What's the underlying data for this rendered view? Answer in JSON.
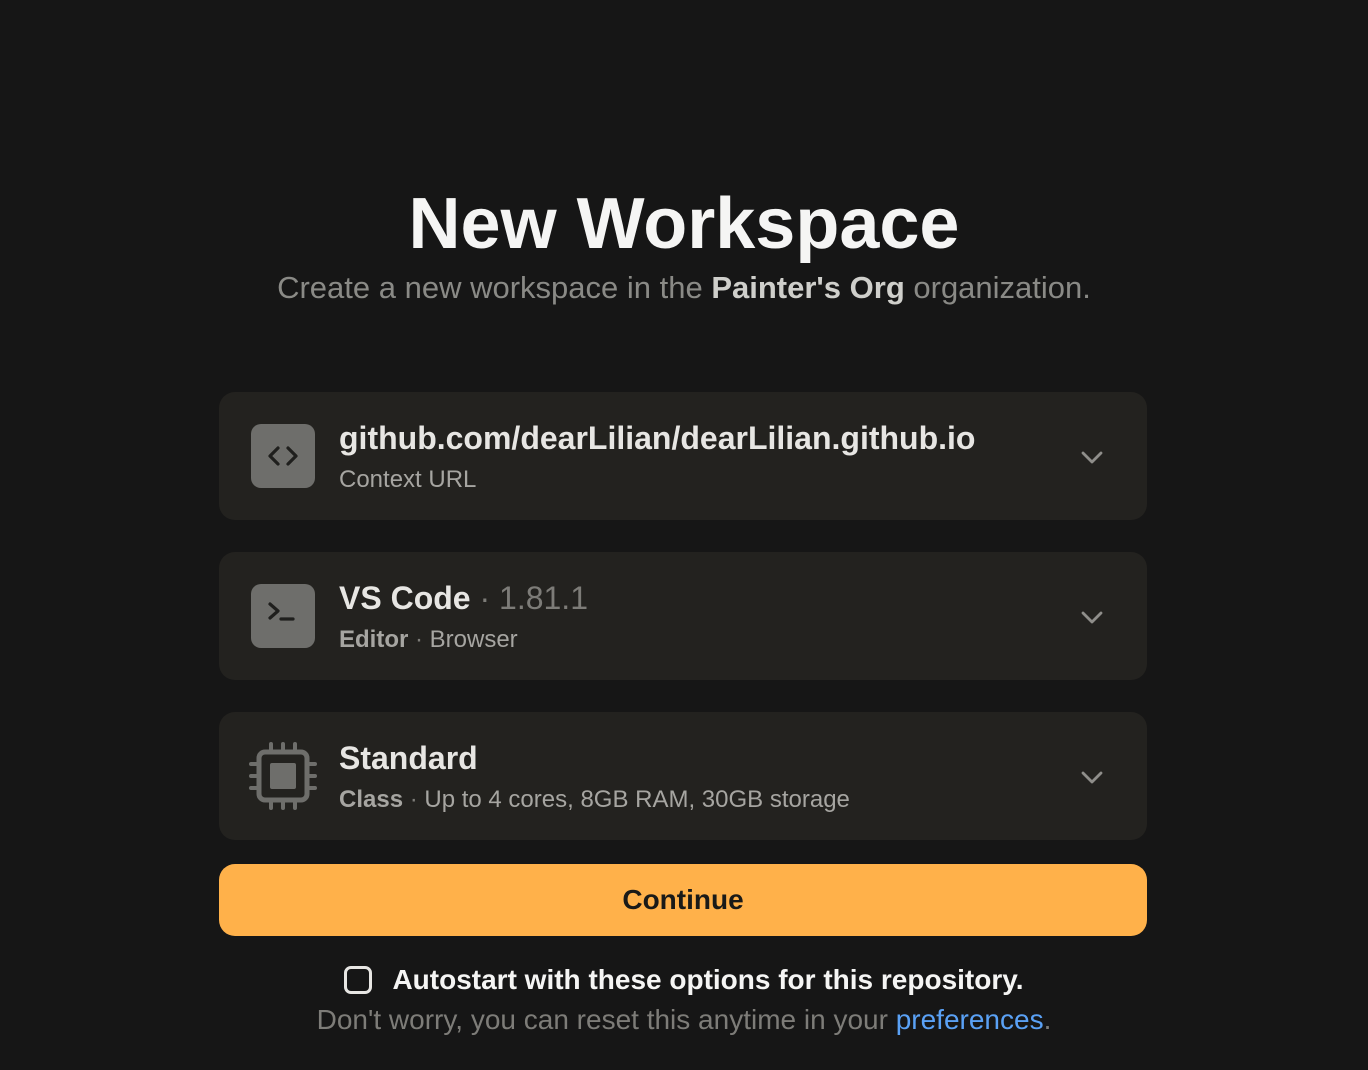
{
  "header": {
    "title": "New Workspace",
    "subtitle_prefix": "Create a new workspace in the ",
    "org_name": "Painter's Org",
    "subtitle_suffix": " organization."
  },
  "context_card": {
    "icon": "code-brackets-icon",
    "primary": "github.com/dearLilian/dearLilian.github.io",
    "secondary": "Context URL"
  },
  "editor_card": {
    "icon": "terminal-icon",
    "name": "VS Code",
    "version": " · 1.81.1",
    "type_label": "Editor",
    "separator": " · ",
    "mode": "Browser"
  },
  "class_card": {
    "icon": "cpu-chip-icon",
    "name": "Standard",
    "type_label": "Class",
    "separator": " · ",
    "spec": "Up to 4 cores, 8GB RAM, 30GB storage"
  },
  "actions": {
    "continue_label": "Continue"
  },
  "autostart": {
    "checked": false,
    "label": "Autostart with these options for this repository.",
    "note_prefix": "Don't worry, you can reset this anytime in your ",
    "link_label": "preferences",
    "note_suffix": "."
  },
  "colors": {
    "background": "#161616",
    "card": "#23221f",
    "accent_button": "#ffb14a",
    "link": "#5aa1f5"
  }
}
